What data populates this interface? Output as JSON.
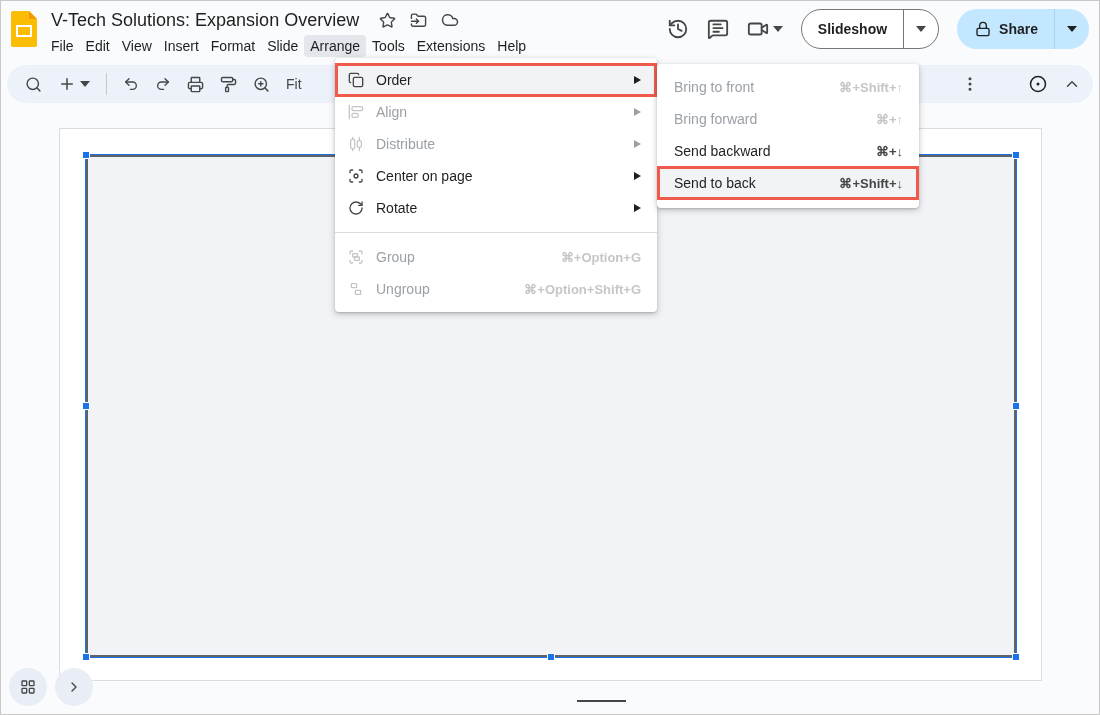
{
  "title": "V-Tech Solutions: Expansion Overview",
  "menubar": [
    {
      "label": "File",
      "selected": false
    },
    {
      "label": "Edit",
      "selected": false
    },
    {
      "label": "View",
      "selected": false
    },
    {
      "label": "Insert",
      "selected": false
    },
    {
      "label": "Format",
      "selected": false
    },
    {
      "label": "Slide",
      "selected": false
    },
    {
      "label": "Arrange",
      "selected": true
    },
    {
      "label": "Tools",
      "selected": false
    },
    {
      "label": "Extensions",
      "selected": false
    },
    {
      "label": "Help",
      "selected": false
    }
  ],
  "toolbar": {
    "zoom": "Fit"
  },
  "buttons": {
    "slideshow": "Slideshow",
    "share": "Share"
  },
  "arrange_menu": [
    {
      "kind": "item",
      "label": "Order",
      "disabled": false,
      "submenu": true,
      "highlighted": true
    },
    {
      "kind": "item",
      "label": "Align",
      "disabled": true,
      "submenu": true,
      "highlighted": false
    },
    {
      "kind": "item",
      "label": "Distribute",
      "disabled": true,
      "submenu": true,
      "highlighted": false
    },
    {
      "kind": "item",
      "label": "Center on page",
      "disabled": false,
      "submenu": true,
      "highlighted": false
    },
    {
      "kind": "item",
      "label": "Rotate",
      "disabled": false,
      "submenu": true,
      "highlighted": false
    },
    {
      "kind": "separator"
    },
    {
      "kind": "item",
      "label": "Group",
      "shortcut": "⌘+Option+G",
      "disabled": true,
      "submenu": false,
      "highlighted": false
    },
    {
      "kind": "item",
      "label": "Ungroup",
      "shortcut": "⌘+Option+Shift+G",
      "disabled": true,
      "submenu": false,
      "highlighted": false
    }
  ],
  "order_submenu": [
    {
      "label": "Bring to front",
      "shortcut": "⌘+Shift+↑",
      "disabled": true,
      "highlighted": false
    },
    {
      "label": "Bring forward",
      "shortcut": "⌘+↑",
      "disabled": true,
      "highlighted": false
    },
    {
      "label": "Send backward",
      "shortcut": "⌘+↓",
      "disabled": false,
      "highlighted": false
    },
    {
      "label": "Send to back",
      "shortcut": "⌘+Shift+↓",
      "disabled": false,
      "highlighted": true
    }
  ]
}
